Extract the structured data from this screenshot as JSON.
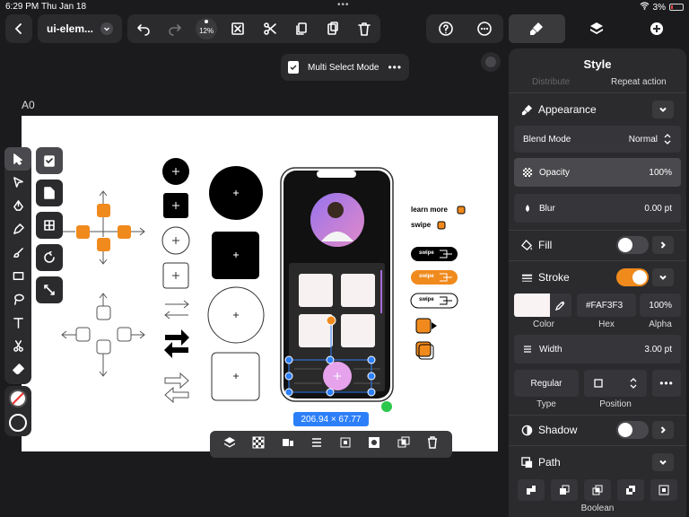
{
  "status": {
    "time": "6:29 PM",
    "date": "Thu Jan 18",
    "battery": "3%"
  },
  "toolbar": {
    "document_name": "ui-elem...",
    "zoom": "12%"
  },
  "mode": {
    "label": "Multi Select Mode"
  },
  "artboard": {
    "label": "A0"
  },
  "selection": {
    "size": "206.94 × 67.77"
  },
  "canvas_content": {
    "learn_more": "learn more",
    "swipe": "swipe",
    "pill_label": "swipe"
  },
  "panel": {
    "title": "Style",
    "distribute": "Distribute",
    "repeat_action": "Repeat action",
    "appearance": {
      "title": "Appearance",
      "blend_label": "Blend Mode",
      "blend_value": "Normal",
      "opacity_label": "Opacity",
      "opacity_value": "100%",
      "blur_label": "Blur",
      "blur_value": "0.00 pt"
    },
    "fill": {
      "title": "Fill",
      "enabled": false
    },
    "stroke": {
      "title": "Stroke",
      "enabled": true,
      "hex": "#FAF3F3",
      "alpha": "100%",
      "color_label": "Color",
      "hex_label": "Hex",
      "alpha_label": "Alpha",
      "width_label": "Width",
      "width_value": "3.00 pt",
      "type_value": "Regular",
      "type_label": "Type",
      "position_label": "Position"
    },
    "shadow": {
      "title": "Shadow",
      "enabled": false
    },
    "path": {
      "title": "Path",
      "boolean_label": "Boolean"
    }
  },
  "colors": {
    "accent_orange": "#f08a1d",
    "selection_blue": "#2d7ff9",
    "stroke_swatch": "#FAF3F3"
  }
}
